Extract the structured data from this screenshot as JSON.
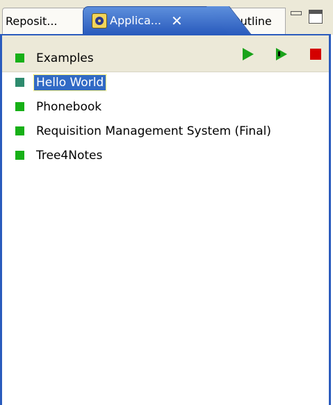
{
  "tabs": [
    {
      "label": "Reposit..."
    },
    {
      "label": "Applica...",
      "close": "✕"
    },
    {
      "label": "Outline"
    }
  ],
  "colors": {
    "accent": "#2a5bbd",
    "run_green": "#1aa31a",
    "stop_red": "#d40000",
    "selection": "#316ac5"
  },
  "toolbar": {
    "icons": [
      "run-icon",
      "run-step-icon",
      "stop-icon"
    ]
  },
  "applications": [
    {
      "label": "Examples",
      "selected": false
    },
    {
      "label": "Hello World",
      "selected": true
    },
    {
      "label": "Phonebook",
      "selected": false
    },
    {
      "label": "Requisition Management System (Final)",
      "selected": false
    },
    {
      "label": "Tree4Notes",
      "selected": false
    }
  ]
}
